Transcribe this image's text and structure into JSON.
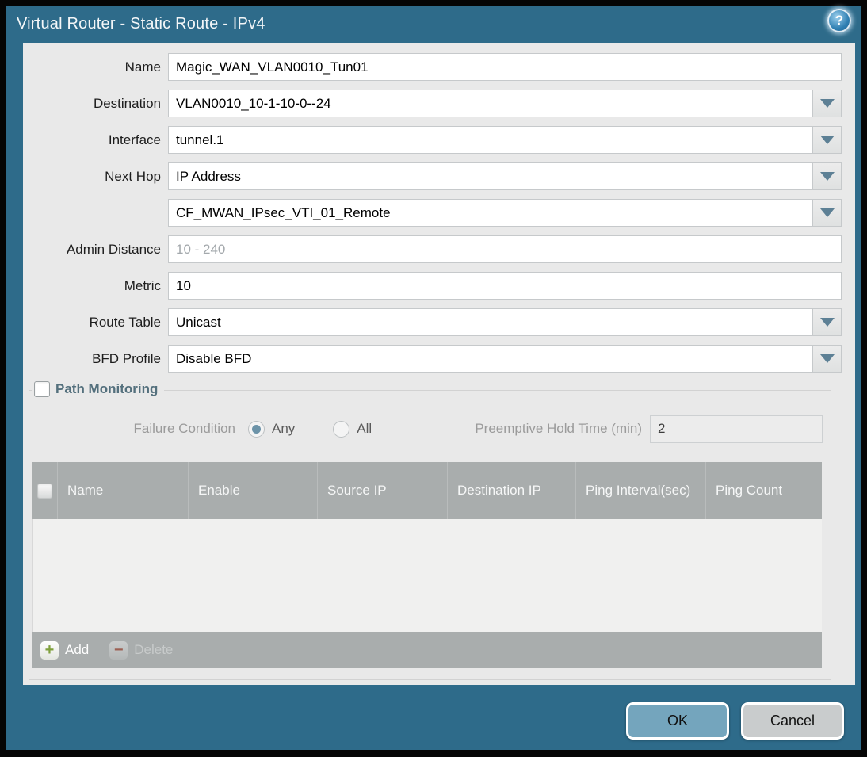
{
  "window": {
    "title": "Virtual Router - Static Route - IPv4",
    "help_glyph": "?",
    "colors": {
      "titlebar": "#2e6b8a",
      "content_bg": "#e9e9e9",
      "table_header": "#a9adad",
      "ok_button": "#74a5bd",
      "cancel_button": "#c9cccd",
      "accent_arrow": "#5d8095"
    }
  },
  "form": {
    "name": {
      "label": "Name",
      "value": "Magic_WAN_VLAN0010_Tun01"
    },
    "destination": {
      "label": "Destination",
      "value": "VLAN0010_10-1-10-0--24"
    },
    "interface": {
      "label": "Interface",
      "value": "tunnel.1"
    },
    "next_hop": {
      "label": "Next Hop",
      "value": "IP Address"
    },
    "next_hop_address": {
      "value": "CF_MWAN_IPsec_VTI_01_Remote"
    },
    "admin_distance": {
      "label": "Admin Distance",
      "placeholder": "10 - 240",
      "value": ""
    },
    "metric": {
      "label": "Metric",
      "value": "10"
    },
    "route_table": {
      "label": "Route Table",
      "value": "Unicast"
    },
    "bfd_profile": {
      "label": "BFD Profile",
      "value": "Disable BFD"
    }
  },
  "path_monitoring": {
    "title": "Path Monitoring",
    "checkbox_checked": false,
    "failure_condition": {
      "label": "Failure Condition",
      "options": [
        {
          "label": "Any",
          "selected": true
        },
        {
          "label": "All",
          "selected": false
        }
      ]
    },
    "preemptive_hold_time": {
      "label": "Preemptive Hold Time (min)",
      "value": "2"
    },
    "table": {
      "columns": [
        "Name",
        "Enable",
        "Source IP",
        "Destination IP",
        "Ping Interval(sec)",
        "Ping Count"
      ],
      "rows": [],
      "add_label": "Add",
      "delete_label": "Delete"
    }
  },
  "footer": {
    "ok_label": "OK",
    "cancel_label": "Cancel"
  }
}
